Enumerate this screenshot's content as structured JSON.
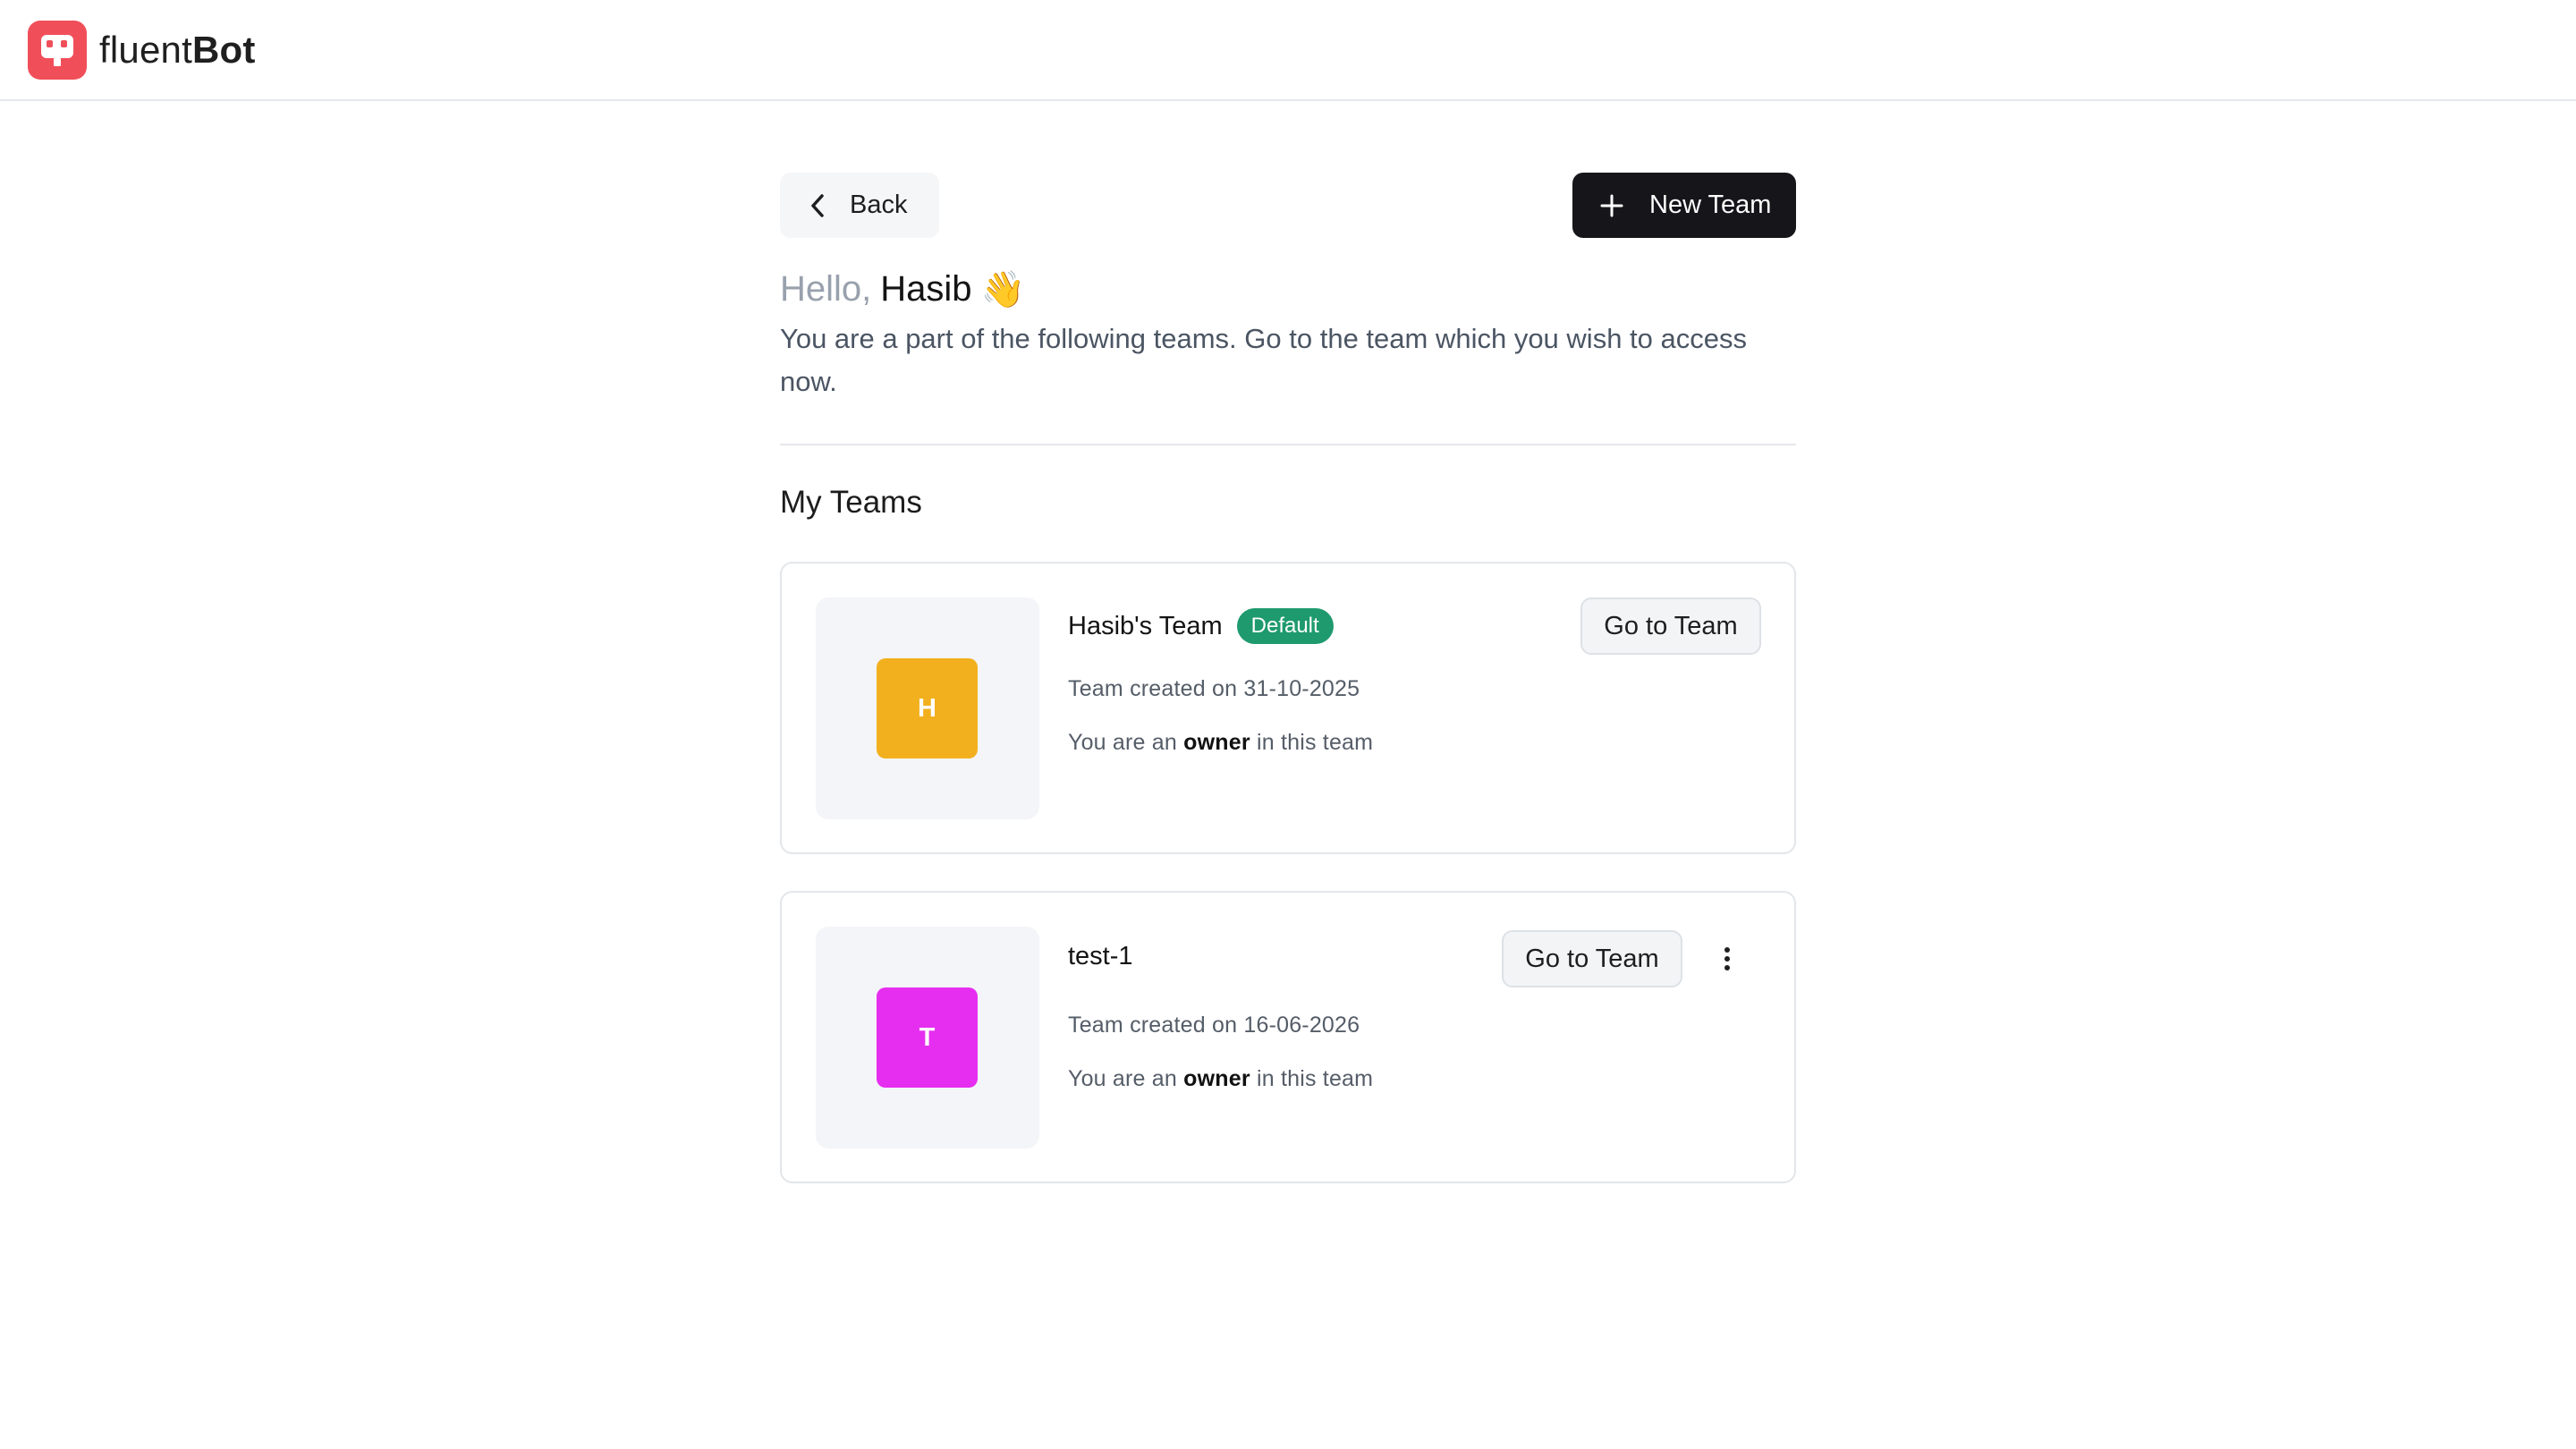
{
  "brand": {
    "name_light": "fluent",
    "name_bold": "Bot",
    "logo_color": "#f04f5a"
  },
  "toolbar": {
    "back_label": "Back",
    "new_team_label": "New Team"
  },
  "greeting": {
    "hello": "Hello,",
    "name": "Hasib",
    "emoji": "👋",
    "subtitle": "You are a part of the following teams. Go to the team which you wish to access now."
  },
  "section": {
    "title": "My Teams"
  },
  "teams": [
    {
      "initial": "H",
      "name": "Hasib's Team",
      "badge": "Default",
      "created": "Team created on 31-10-2025",
      "role_prefix": "You are an ",
      "role": "owner",
      "role_suffix": " in this team",
      "go_label": "Go to Team",
      "color": "#f2b01e"
    },
    {
      "initial": "T",
      "name": "test-1",
      "badge": "",
      "created": "Team created on 16-06-2026",
      "role_prefix": "You are an ",
      "role": "owner",
      "role_suffix": " in this team",
      "go_label": "Go to Team",
      "color": "#e62ef0"
    }
  ],
  "colors": {
    "primary_button": "#16161a",
    "badge_green": "#1f9a6f"
  }
}
